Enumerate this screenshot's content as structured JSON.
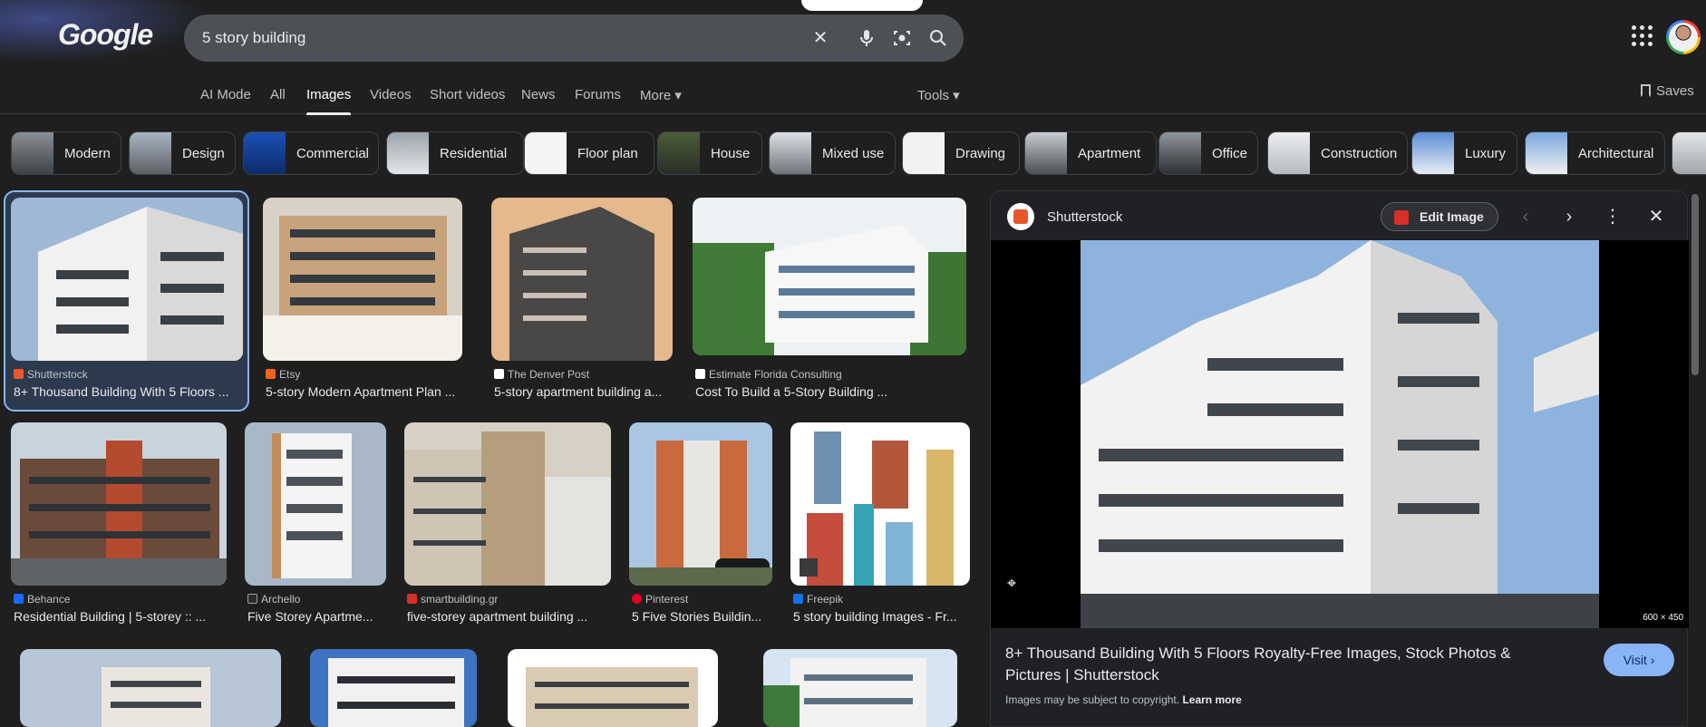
{
  "header": {
    "logo": "Google",
    "query": "5 story building",
    "icons": [
      "clear-icon",
      "mic-icon",
      "lens-icon",
      "search-icon",
      "apps-icon"
    ],
    "saves": "Saves"
  },
  "tabs": [
    "AI Mode",
    "All",
    "Images",
    "Videos",
    "Short videos",
    "News",
    "Forums",
    "More ▾"
  ],
  "active_tab": "Images",
  "tools": "Tools ▾",
  "chips": [
    "Modern",
    "Design",
    "Commercial",
    "Residential",
    "Floor plan",
    "House",
    "Mixed use",
    "Drawing",
    "Apartment",
    "Office",
    "Construction",
    "Luxury",
    "Architectural"
  ],
  "results": [
    {
      "source": "Shutterstock",
      "title": "8+ Thousand Building With 5 Floors ...",
      "source_color": "#e8572a"
    },
    {
      "source": "Etsy",
      "title": "5-story Modern Apartment Plan ...",
      "source_color": "#f1641e"
    },
    {
      "source": "The Denver Post",
      "title": "5-story apartment building a...",
      "source_color": "#ffffff"
    },
    {
      "source": "Estimate Florida Consulting",
      "title": "Cost To Build a 5-Story Building ...",
      "source_color": "#ffffff"
    },
    {
      "source": "Behance",
      "title": "Residential Building | 5-storey :: ...",
      "source_color": "#1769ff"
    },
    {
      "source": "Archello",
      "title": "Five Storey Apartme...",
      "source_color": "#2b2b2b"
    },
    {
      "source": "smartbuilding.gr",
      "title": "five-storey apartment building ...",
      "source_color": "#d93025"
    },
    {
      "source": "Pinterest",
      "title": "5 Five Stories Buildin...",
      "source_color": "#e60023"
    },
    {
      "source": "Freepik",
      "title": "5 story building Images - Fr...",
      "source_color": "#1273eb"
    }
  ],
  "panel": {
    "source": "Shutterstock",
    "edit_label": "Edit Image",
    "dims": "600 × 450",
    "title": "8+ Thousand Building With 5 Floors Royalty-Free Images, Stock Photos & Pictures | Shutterstock",
    "copyright": "Images may be subject to copyright.",
    "learn_more": "Learn more",
    "visit": "Visit ›"
  }
}
